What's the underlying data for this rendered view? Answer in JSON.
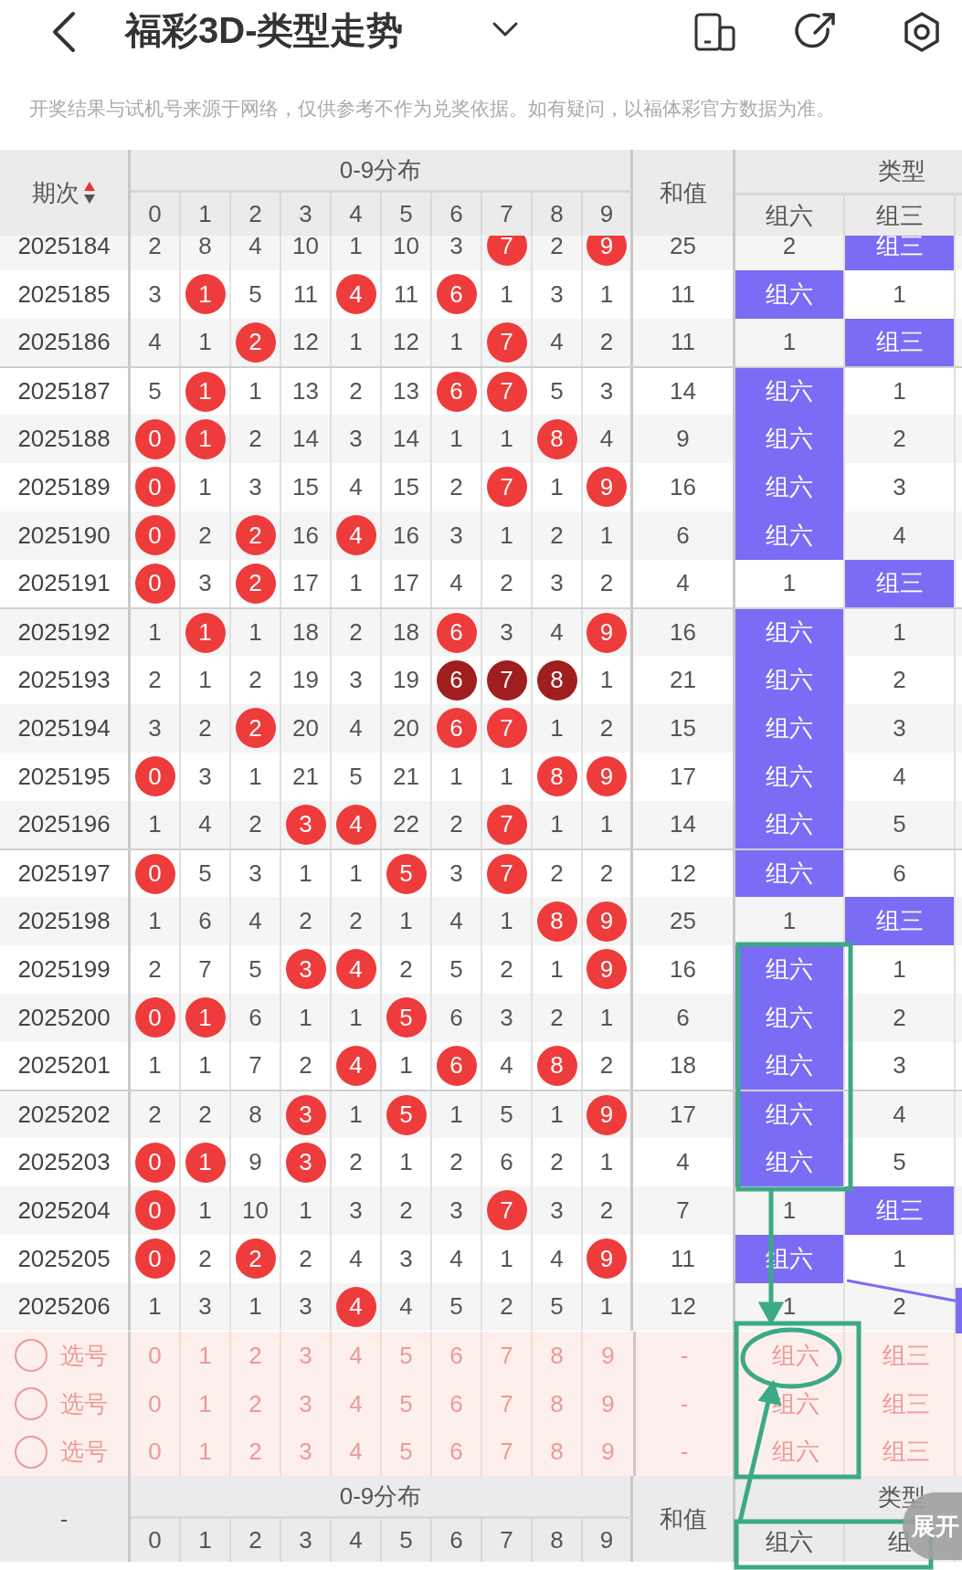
{
  "header": {
    "title": "福彩3D-类型走势"
  },
  "notice": "开奖结果与试机号来源于网络，仅供参考不作为兑奖依据。如有疑问，以福体彩官方数据为准。",
  "table": {
    "columns": {
      "period": "期次",
      "sort_ascending": true,
      "distribution": "0-9分布",
      "digits": [
        "0",
        "1",
        "2",
        "3",
        "4",
        "5",
        "6",
        "7",
        "8",
        "9"
      ],
      "sum": "和值",
      "type": "类型",
      "type_columns": [
        "组六",
        "组三"
      ]
    },
    "rows": [
      {
        "period": "2025184",
        "cells": [
          {
            "value": "2",
            "kind": "plain"
          },
          {
            "value": "8",
            "kind": "plain"
          },
          {
            "value": "4",
            "kind": "plain"
          },
          {
            "value": "10",
            "kind": "plain"
          },
          {
            "value": "1",
            "kind": "plain"
          },
          {
            "value": "10",
            "kind": "plain"
          },
          {
            "value": "3",
            "kind": "plain"
          },
          {
            "value": "7",
            "kind": "hit"
          },
          {
            "value": "2",
            "kind": "plain"
          },
          {
            "value": "9",
            "kind": "hit"
          }
        ],
        "sum": "25",
        "types": [
          {
            "text": "2",
            "hit": false
          },
          {
            "text": "组三",
            "hit": true
          }
        ]
      },
      {
        "period": "2025185",
        "cells": [
          {
            "value": "3",
            "kind": "plain"
          },
          {
            "value": "1",
            "kind": "hit"
          },
          {
            "value": "5",
            "kind": "plain"
          },
          {
            "value": "11",
            "kind": "plain"
          },
          {
            "value": "4",
            "kind": "hit"
          },
          {
            "value": "11",
            "kind": "plain"
          },
          {
            "value": "6",
            "kind": "hit"
          },
          {
            "value": "1",
            "kind": "plain"
          },
          {
            "value": "3",
            "kind": "plain"
          },
          {
            "value": "1",
            "kind": "plain"
          }
        ],
        "sum": "11",
        "types": [
          {
            "text": "组六",
            "hit": true
          },
          {
            "text": "1",
            "hit": false
          }
        ]
      },
      {
        "period": "2025186",
        "cells": [
          {
            "value": "4",
            "kind": "plain"
          },
          {
            "value": "1",
            "kind": "plain"
          },
          {
            "value": "2",
            "kind": "hit"
          },
          {
            "value": "12",
            "kind": "plain"
          },
          {
            "value": "1",
            "kind": "plain"
          },
          {
            "value": "12",
            "kind": "plain"
          },
          {
            "value": "1",
            "kind": "plain"
          },
          {
            "value": "7",
            "kind": "hit"
          },
          {
            "value": "4",
            "kind": "plain"
          },
          {
            "value": "2",
            "kind": "plain"
          }
        ],
        "sum": "11",
        "types": [
          {
            "text": "1",
            "hit": false
          },
          {
            "text": "组三",
            "hit": true
          }
        ]
      },
      {
        "period": "2025187",
        "cells": [
          {
            "value": "5",
            "kind": "plain"
          },
          {
            "value": "1",
            "kind": "hit"
          },
          {
            "value": "1",
            "kind": "plain"
          },
          {
            "value": "13",
            "kind": "plain"
          },
          {
            "value": "2",
            "kind": "plain"
          },
          {
            "value": "13",
            "kind": "plain"
          },
          {
            "value": "6",
            "kind": "hit"
          },
          {
            "value": "7",
            "kind": "hit"
          },
          {
            "value": "5",
            "kind": "plain"
          },
          {
            "value": "3",
            "kind": "plain"
          }
        ],
        "sum": "14",
        "types": [
          {
            "text": "组六",
            "hit": true
          },
          {
            "text": "1",
            "hit": false
          }
        ]
      },
      {
        "period": "2025188",
        "cells": [
          {
            "value": "0",
            "kind": "hit"
          },
          {
            "value": "1",
            "kind": "hit"
          },
          {
            "value": "2",
            "kind": "plain"
          },
          {
            "value": "14",
            "kind": "plain"
          },
          {
            "value": "3",
            "kind": "plain"
          },
          {
            "value": "14",
            "kind": "plain"
          },
          {
            "value": "1",
            "kind": "plain"
          },
          {
            "value": "1",
            "kind": "plain"
          },
          {
            "value": "8",
            "kind": "hit"
          },
          {
            "value": "4",
            "kind": "plain"
          }
        ],
        "sum": "9",
        "types": [
          {
            "text": "组六",
            "hit": true
          },
          {
            "text": "2",
            "hit": false
          }
        ]
      },
      {
        "period": "2025189",
        "cells": [
          {
            "value": "0",
            "kind": "hit"
          },
          {
            "value": "1",
            "kind": "plain"
          },
          {
            "value": "3",
            "kind": "plain"
          },
          {
            "value": "15",
            "kind": "plain"
          },
          {
            "value": "4",
            "kind": "plain"
          },
          {
            "value": "15",
            "kind": "plain"
          },
          {
            "value": "2",
            "kind": "plain"
          },
          {
            "value": "7",
            "kind": "hit"
          },
          {
            "value": "1",
            "kind": "plain"
          },
          {
            "value": "9",
            "kind": "hit"
          }
        ],
        "sum": "16",
        "types": [
          {
            "text": "组六",
            "hit": true
          },
          {
            "text": "3",
            "hit": false
          }
        ]
      },
      {
        "period": "2025190",
        "cells": [
          {
            "value": "0",
            "kind": "hit"
          },
          {
            "value": "2",
            "kind": "plain"
          },
          {
            "value": "2",
            "kind": "hit"
          },
          {
            "value": "16",
            "kind": "plain"
          },
          {
            "value": "4",
            "kind": "hit"
          },
          {
            "value": "16",
            "kind": "plain"
          },
          {
            "value": "3",
            "kind": "plain"
          },
          {
            "value": "1",
            "kind": "plain"
          },
          {
            "value": "2",
            "kind": "plain"
          },
          {
            "value": "1",
            "kind": "plain"
          }
        ],
        "sum": "6",
        "types": [
          {
            "text": "组六",
            "hit": true
          },
          {
            "text": "4",
            "hit": false
          }
        ]
      },
      {
        "period": "2025191",
        "cells": [
          {
            "value": "0",
            "kind": "hit"
          },
          {
            "value": "3",
            "kind": "plain"
          },
          {
            "value": "2",
            "kind": "hit"
          },
          {
            "value": "17",
            "kind": "plain"
          },
          {
            "value": "1",
            "kind": "plain"
          },
          {
            "value": "17",
            "kind": "plain"
          },
          {
            "value": "4",
            "kind": "plain"
          },
          {
            "value": "2",
            "kind": "plain"
          },
          {
            "value": "3",
            "kind": "plain"
          },
          {
            "value": "2",
            "kind": "plain"
          }
        ],
        "sum": "4",
        "types": [
          {
            "text": "1",
            "hit": false
          },
          {
            "text": "组三",
            "hit": true
          }
        ]
      },
      {
        "period": "2025192",
        "cells": [
          {
            "value": "1",
            "kind": "plain"
          },
          {
            "value": "1",
            "kind": "hit"
          },
          {
            "value": "1",
            "kind": "plain"
          },
          {
            "value": "18",
            "kind": "plain"
          },
          {
            "value": "2",
            "kind": "plain"
          },
          {
            "value": "18",
            "kind": "plain"
          },
          {
            "value": "6",
            "kind": "hit"
          },
          {
            "value": "3",
            "kind": "plain"
          },
          {
            "value": "4",
            "kind": "plain"
          },
          {
            "value": "9",
            "kind": "hit"
          }
        ],
        "sum": "16",
        "types": [
          {
            "text": "组六",
            "hit": true
          },
          {
            "text": "1",
            "hit": false
          }
        ]
      },
      {
        "period": "2025193",
        "cells": [
          {
            "value": "2",
            "kind": "plain"
          },
          {
            "value": "1",
            "kind": "plain"
          },
          {
            "value": "2",
            "kind": "plain"
          },
          {
            "value": "19",
            "kind": "plain"
          },
          {
            "value": "3",
            "kind": "plain"
          },
          {
            "value": "19",
            "kind": "plain"
          },
          {
            "value": "6",
            "kind": "repeat"
          },
          {
            "value": "7",
            "kind": "repeat"
          },
          {
            "value": "8",
            "kind": "repeat"
          },
          {
            "value": "1",
            "kind": "plain"
          }
        ],
        "sum": "21",
        "types": [
          {
            "text": "组六",
            "hit": true
          },
          {
            "text": "2",
            "hit": false
          }
        ]
      },
      {
        "period": "2025194",
        "cells": [
          {
            "value": "3",
            "kind": "plain"
          },
          {
            "value": "2",
            "kind": "plain"
          },
          {
            "value": "2",
            "kind": "hit"
          },
          {
            "value": "20",
            "kind": "plain"
          },
          {
            "value": "4",
            "kind": "plain"
          },
          {
            "value": "20",
            "kind": "plain"
          },
          {
            "value": "6",
            "kind": "hit"
          },
          {
            "value": "7",
            "kind": "hit"
          },
          {
            "value": "1",
            "kind": "plain"
          },
          {
            "value": "2",
            "kind": "plain"
          }
        ],
        "sum": "15",
        "types": [
          {
            "text": "组六",
            "hit": true
          },
          {
            "text": "3",
            "hit": false
          }
        ]
      },
      {
        "period": "2025195",
        "cells": [
          {
            "value": "0",
            "kind": "hit"
          },
          {
            "value": "3",
            "kind": "plain"
          },
          {
            "value": "1",
            "kind": "plain"
          },
          {
            "value": "21",
            "kind": "plain"
          },
          {
            "value": "5",
            "kind": "plain"
          },
          {
            "value": "21",
            "kind": "plain"
          },
          {
            "value": "1",
            "kind": "plain"
          },
          {
            "value": "1",
            "kind": "plain"
          },
          {
            "value": "8",
            "kind": "hit"
          },
          {
            "value": "9",
            "kind": "hit"
          }
        ],
        "sum": "17",
        "types": [
          {
            "text": "组六",
            "hit": true
          },
          {
            "text": "4",
            "hit": false
          }
        ]
      },
      {
        "period": "2025196",
        "cells": [
          {
            "value": "1",
            "kind": "plain"
          },
          {
            "value": "4",
            "kind": "plain"
          },
          {
            "value": "2",
            "kind": "plain"
          },
          {
            "value": "3",
            "kind": "hit"
          },
          {
            "value": "4",
            "kind": "hit"
          },
          {
            "value": "22",
            "kind": "plain"
          },
          {
            "value": "2",
            "kind": "plain"
          },
          {
            "value": "7",
            "kind": "hit"
          },
          {
            "value": "1",
            "kind": "plain"
          },
          {
            "value": "1",
            "kind": "plain"
          }
        ],
        "sum": "14",
        "types": [
          {
            "text": "组六",
            "hit": true
          },
          {
            "text": "5",
            "hit": false
          }
        ]
      },
      {
        "period": "2025197",
        "cells": [
          {
            "value": "0",
            "kind": "hit"
          },
          {
            "value": "5",
            "kind": "plain"
          },
          {
            "value": "3",
            "kind": "plain"
          },
          {
            "value": "1",
            "kind": "plain"
          },
          {
            "value": "1",
            "kind": "plain"
          },
          {
            "value": "5",
            "kind": "hit"
          },
          {
            "value": "3",
            "kind": "plain"
          },
          {
            "value": "7",
            "kind": "hit"
          },
          {
            "value": "2",
            "kind": "plain"
          },
          {
            "value": "2",
            "kind": "plain"
          }
        ],
        "sum": "12",
        "types": [
          {
            "text": "组六",
            "hit": true
          },
          {
            "text": "6",
            "hit": false
          }
        ]
      },
      {
        "period": "2025198",
        "cells": [
          {
            "value": "1",
            "kind": "plain"
          },
          {
            "value": "6",
            "kind": "plain"
          },
          {
            "value": "4",
            "kind": "plain"
          },
          {
            "value": "2",
            "kind": "plain"
          },
          {
            "value": "2",
            "kind": "plain"
          },
          {
            "value": "1",
            "kind": "plain"
          },
          {
            "value": "4",
            "kind": "plain"
          },
          {
            "value": "1",
            "kind": "plain"
          },
          {
            "value": "8",
            "kind": "hit"
          },
          {
            "value": "9",
            "kind": "hit"
          }
        ],
        "sum": "25",
        "types": [
          {
            "text": "1",
            "hit": false
          },
          {
            "text": "组三",
            "hit": true
          }
        ]
      },
      {
        "period": "2025199",
        "cells": [
          {
            "value": "2",
            "kind": "plain"
          },
          {
            "value": "7",
            "kind": "plain"
          },
          {
            "value": "5",
            "kind": "plain"
          },
          {
            "value": "3",
            "kind": "hit"
          },
          {
            "value": "4",
            "kind": "hit"
          },
          {
            "value": "2",
            "kind": "plain"
          },
          {
            "value": "5",
            "kind": "plain"
          },
          {
            "value": "2",
            "kind": "plain"
          },
          {
            "value": "1",
            "kind": "plain"
          },
          {
            "value": "9",
            "kind": "hit"
          }
        ],
        "sum": "16",
        "types": [
          {
            "text": "组六",
            "hit": true
          },
          {
            "text": "1",
            "hit": false
          }
        ]
      },
      {
        "period": "2025200",
        "cells": [
          {
            "value": "0",
            "kind": "hit"
          },
          {
            "value": "1",
            "kind": "hit"
          },
          {
            "value": "6",
            "kind": "plain"
          },
          {
            "value": "1",
            "kind": "plain"
          },
          {
            "value": "1",
            "kind": "plain"
          },
          {
            "value": "5",
            "kind": "hit"
          },
          {
            "value": "6",
            "kind": "plain"
          },
          {
            "value": "3",
            "kind": "plain"
          },
          {
            "value": "2",
            "kind": "plain"
          },
          {
            "value": "1",
            "kind": "plain"
          }
        ],
        "sum": "6",
        "types": [
          {
            "text": "组六",
            "hit": true
          },
          {
            "text": "2",
            "hit": false
          }
        ]
      },
      {
        "period": "2025201",
        "cells": [
          {
            "value": "1",
            "kind": "plain"
          },
          {
            "value": "1",
            "kind": "plain"
          },
          {
            "value": "7",
            "kind": "plain"
          },
          {
            "value": "2",
            "kind": "plain"
          },
          {
            "value": "4",
            "kind": "hit"
          },
          {
            "value": "1",
            "kind": "plain"
          },
          {
            "value": "6",
            "kind": "hit"
          },
          {
            "value": "4",
            "kind": "plain"
          },
          {
            "value": "8",
            "kind": "hit"
          },
          {
            "value": "2",
            "kind": "plain"
          }
        ],
        "sum": "18",
        "types": [
          {
            "text": "组六",
            "hit": true
          },
          {
            "text": "3",
            "hit": false
          }
        ]
      },
      {
        "period": "2025202",
        "cells": [
          {
            "value": "2",
            "kind": "plain"
          },
          {
            "value": "2",
            "kind": "plain"
          },
          {
            "value": "8",
            "kind": "plain"
          },
          {
            "value": "3",
            "kind": "hit"
          },
          {
            "value": "1",
            "kind": "plain"
          },
          {
            "value": "5",
            "kind": "hit"
          },
          {
            "value": "1",
            "kind": "plain"
          },
          {
            "value": "5",
            "kind": "plain"
          },
          {
            "value": "1",
            "kind": "plain"
          },
          {
            "value": "9",
            "kind": "hit"
          }
        ],
        "sum": "17",
        "types": [
          {
            "text": "组六",
            "hit": true
          },
          {
            "text": "4",
            "hit": false
          }
        ]
      },
      {
        "period": "2025203",
        "cells": [
          {
            "value": "0",
            "kind": "hit"
          },
          {
            "value": "1",
            "kind": "hit"
          },
          {
            "value": "9",
            "kind": "plain"
          },
          {
            "value": "3",
            "kind": "hit"
          },
          {
            "value": "2",
            "kind": "plain"
          },
          {
            "value": "1",
            "kind": "plain"
          },
          {
            "value": "2",
            "kind": "plain"
          },
          {
            "value": "6",
            "kind": "plain"
          },
          {
            "value": "2",
            "kind": "plain"
          },
          {
            "value": "1",
            "kind": "plain"
          }
        ],
        "sum": "4",
        "types": [
          {
            "text": "组六",
            "hit": true
          },
          {
            "text": "5",
            "hit": false
          }
        ]
      },
      {
        "period": "2025204",
        "cells": [
          {
            "value": "0",
            "kind": "hit"
          },
          {
            "value": "1",
            "kind": "plain"
          },
          {
            "value": "10",
            "kind": "plain"
          },
          {
            "value": "1",
            "kind": "plain"
          },
          {
            "value": "3",
            "kind": "plain"
          },
          {
            "value": "2",
            "kind": "plain"
          },
          {
            "value": "3",
            "kind": "plain"
          },
          {
            "value": "7",
            "kind": "hit"
          },
          {
            "value": "3",
            "kind": "plain"
          },
          {
            "value": "2",
            "kind": "plain"
          }
        ],
        "sum": "7",
        "types": [
          {
            "text": "1",
            "hit": false
          },
          {
            "text": "组三",
            "hit": true
          }
        ]
      },
      {
        "period": "2025205",
        "cells": [
          {
            "value": "0",
            "kind": "hit"
          },
          {
            "value": "2",
            "kind": "plain"
          },
          {
            "value": "2",
            "kind": "hit"
          },
          {
            "value": "2",
            "kind": "plain"
          },
          {
            "value": "4",
            "kind": "plain"
          },
          {
            "value": "3",
            "kind": "plain"
          },
          {
            "value": "4",
            "kind": "plain"
          },
          {
            "value": "1",
            "kind": "plain"
          },
          {
            "value": "4",
            "kind": "plain"
          },
          {
            "value": "9",
            "kind": "hit"
          }
        ],
        "sum": "11",
        "types": [
          {
            "text": "组六",
            "hit": true
          },
          {
            "text": "1",
            "hit": false
          }
        ]
      },
      {
        "period": "2025206",
        "cells": [
          {
            "value": "1",
            "kind": "plain"
          },
          {
            "value": "3",
            "kind": "plain"
          },
          {
            "value": "1",
            "kind": "plain"
          },
          {
            "value": "3",
            "kind": "plain"
          },
          {
            "value": "4",
            "kind": "hit"
          },
          {
            "value": "4",
            "kind": "plain"
          },
          {
            "value": "5",
            "kind": "plain"
          },
          {
            "value": "2",
            "kind": "plain"
          },
          {
            "value": "5",
            "kind": "plain"
          },
          {
            "value": "1",
            "kind": "plain"
          }
        ],
        "sum": "12",
        "types": [
          {
            "text": "1",
            "hit": false
          },
          {
            "text": "2",
            "hit": false
          }
        ]
      }
    ],
    "picks": [
      {
        "label": "选号",
        "checked": false,
        "digits": [
          "0",
          "1",
          "2",
          "3",
          "4",
          "5",
          "6",
          "7",
          "8",
          "9"
        ],
        "sum": "-",
        "types": [
          "组六",
          "组三"
        ]
      },
      {
        "label": "选号",
        "checked": false,
        "digits": [
          "0",
          "1",
          "2",
          "3",
          "4",
          "5",
          "6",
          "7",
          "8",
          "9"
        ],
        "sum": "-",
        "types": [
          "组六",
          "组三"
        ]
      },
      {
        "label": "选号",
        "checked": false,
        "digits": [
          "0",
          "1",
          "2",
          "3",
          "4",
          "5",
          "6",
          "7",
          "8",
          "9"
        ],
        "sum": "-",
        "types": [
          "组六",
          "组三"
        ]
      }
    ],
    "footer_header": {
      "period": "-",
      "distribution": "0-9分布",
      "digits": [
        "0",
        "1",
        "2",
        "3",
        "4",
        "5",
        "6",
        "7",
        "8",
        "9"
      ],
      "sum": "和值",
      "type": "类型",
      "type_columns": [
        "组六",
        "组"
      ]
    }
  },
  "expand_button": "展开"
}
